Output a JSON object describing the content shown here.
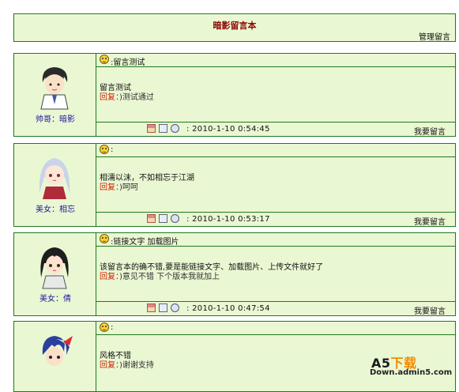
{
  "header": {
    "title": "暗影留言本",
    "manage_link": "管理留言"
  },
  "posts": [
    {
      "nickname": "帅哥：暗影",
      "subject": ":留言测试",
      "content": "留言测试",
      "reply_label": "回复：",
      "reply_text": ")测试通过",
      "timestamp": ": 2010-1-10 0:54:45",
      "leave_message": "我要留言"
    },
    {
      "nickname": "美女：相忘",
      "subject": ":",
      "content": "相濡以沫，不如相忘于江湖",
      "reply_label": "回复：",
      "reply_text": ")呵呵",
      "timestamp": ": 2010-1-10 0:53:17",
      "leave_message": "我要留言"
    },
    {
      "nickname": "美女：倩",
      "subject": ":链接文字 加载图片",
      "content": "该留言本的确不错,要是能链接文字、加载图片、上传文件就好了",
      "reply_label": "回复：",
      "reply_text": ")意见不错 下个版本我就加上",
      "timestamp": ": 2010-1-10 0:47:54",
      "leave_message": "我要留言"
    },
    {
      "nickname": "",
      "subject": ":",
      "content": "风格不错",
      "reply_label": "回复：",
      "reply_text": ")谢谢支持",
      "timestamp": "",
      "leave_message": ""
    }
  ],
  "watermark": {
    "brand_a": "A5",
    "brand_b": "下载",
    "site": "Down.admin5.com"
  },
  "colors": {
    "panel_bg": "#eaf7d3",
    "border": "#1f7a1f",
    "title": "#8b0000",
    "reply_label": "#cc2200"
  }
}
